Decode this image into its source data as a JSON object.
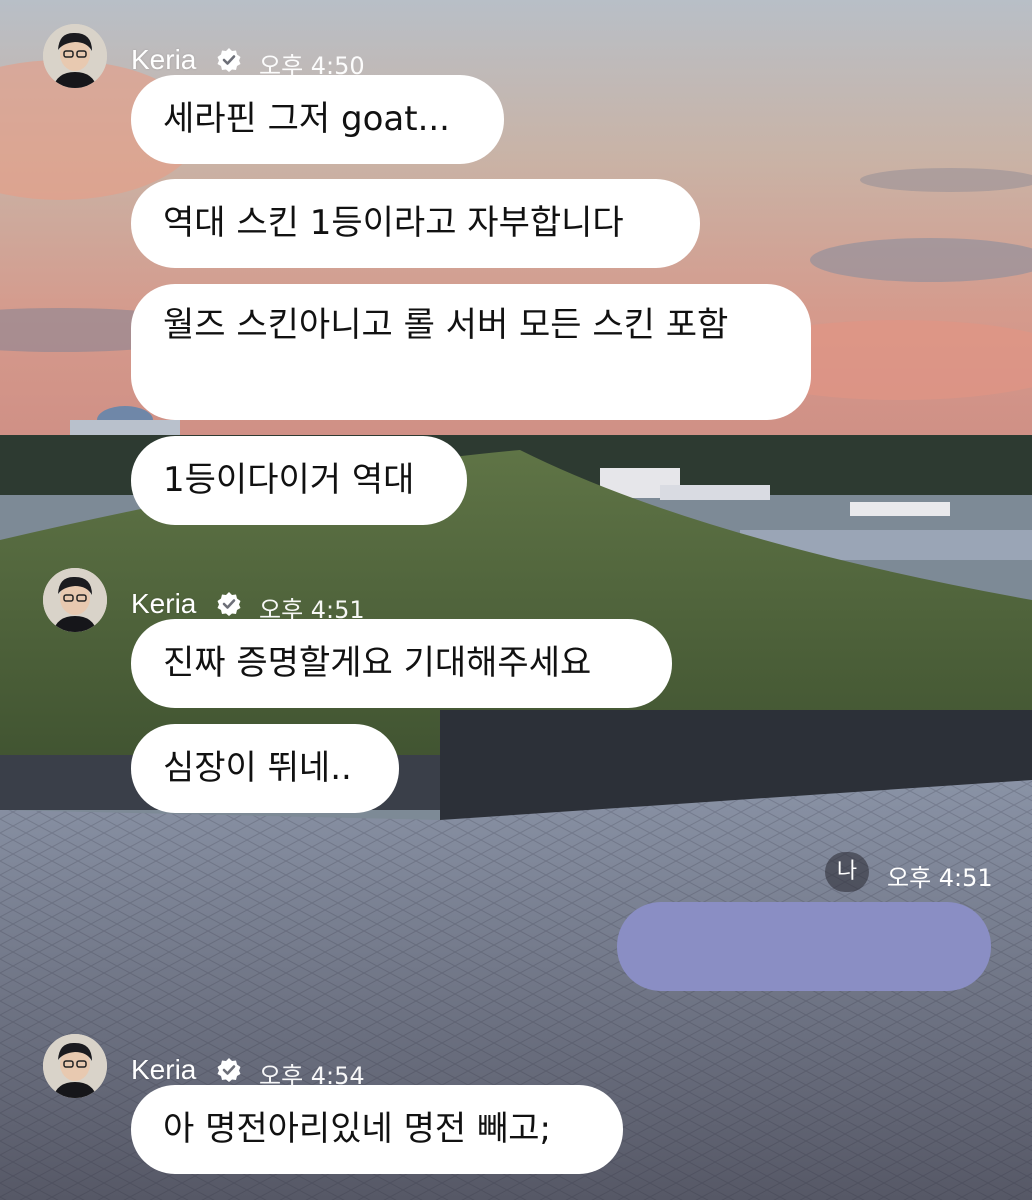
{
  "sender": {
    "name": "Keria",
    "verified": true
  },
  "me": {
    "label": "나",
    "time": "오후 4:51"
  },
  "groups": [
    {
      "time": "오후 4:50",
      "messages": [
        "세라핀 그저 goat...",
        "역대 스킨 1등이라고 자부합니다",
        "월즈 스킨아니고 롤 서버 모든 스킨 포함",
        "1등이다이거 역대"
      ]
    },
    {
      "time": "오후 4:51",
      "messages": [
        "진짜 증명할게요 기대해주세요",
        "심장이 뛰네.."
      ]
    },
    {
      "time": "오후 4:54",
      "messages": [
        "아 명전아리있네 명전 빼고;"
      ]
    }
  ],
  "colors": {
    "bubble": "#ffffff",
    "my_bubble": "#8a8ec4"
  }
}
